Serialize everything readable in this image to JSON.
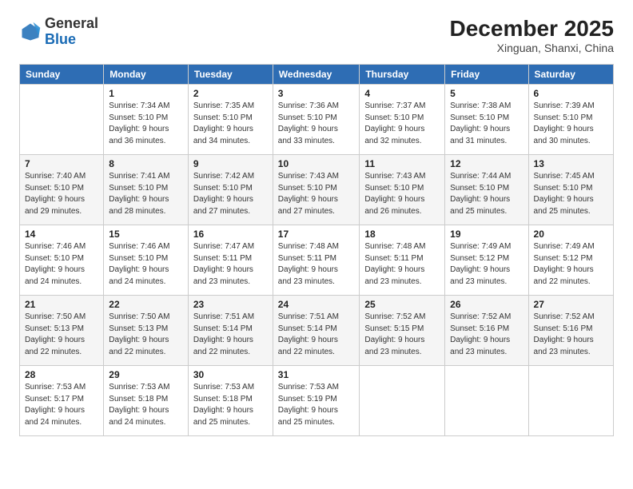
{
  "header": {
    "logo_general": "General",
    "logo_blue": "Blue",
    "month_title": "December 2025",
    "location": "Xinguan, Shanxi, China"
  },
  "columns": [
    "Sunday",
    "Monday",
    "Tuesday",
    "Wednesday",
    "Thursday",
    "Friday",
    "Saturday"
  ],
  "weeks": [
    [
      {
        "day": "",
        "info": ""
      },
      {
        "day": "1",
        "info": "Sunrise: 7:34 AM\nSunset: 5:10 PM\nDaylight: 9 hours\nand 36 minutes."
      },
      {
        "day": "2",
        "info": "Sunrise: 7:35 AM\nSunset: 5:10 PM\nDaylight: 9 hours\nand 34 minutes."
      },
      {
        "day": "3",
        "info": "Sunrise: 7:36 AM\nSunset: 5:10 PM\nDaylight: 9 hours\nand 33 minutes."
      },
      {
        "day": "4",
        "info": "Sunrise: 7:37 AM\nSunset: 5:10 PM\nDaylight: 9 hours\nand 32 minutes."
      },
      {
        "day": "5",
        "info": "Sunrise: 7:38 AM\nSunset: 5:10 PM\nDaylight: 9 hours\nand 31 minutes."
      },
      {
        "day": "6",
        "info": "Sunrise: 7:39 AM\nSunset: 5:10 PM\nDaylight: 9 hours\nand 30 minutes."
      }
    ],
    [
      {
        "day": "7",
        "info": "Sunrise: 7:40 AM\nSunset: 5:10 PM\nDaylight: 9 hours\nand 29 minutes."
      },
      {
        "day": "8",
        "info": "Sunrise: 7:41 AM\nSunset: 5:10 PM\nDaylight: 9 hours\nand 28 minutes."
      },
      {
        "day": "9",
        "info": "Sunrise: 7:42 AM\nSunset: 5:10 PM\nDaylight: 9 hours\nand 27 minutes."
      },
      {
        "day": "10",
        "info": "Sunrise: 7:43 AM\nSunset: 5:10 PM\nDaylight: 9 hours\nand 27 minutes."
      },
      {
        "day": "11",
        "info": "Sunrise: 7:43 AM\nSunset: 5:10 PM\nDaylight: 9 hours\nand 26 minutes."
      },
      {
        "day": "12",
        "info": "Sunrise: 7:44 AM\nSunset: 5:10 PM\nDaylight: 9 hours\nand 25 minutes."
      },
      {
        "day": "13",
        "info": "Sunrise: 7:45 AM\nSunset: 5:10 PM\nDaylight: 9 hours\nand 25 minutes."
      }
    ],
    [
      {
        "day": "14",
        "info": "Sunrise: 7:46 AM\nSunset: 5:10 PM\nDaylight: 9 hours\nand 24 minutes."
      },
      {
        "day": "15",
        "info": "Sunrise: 7:46 AM\nSunset: 5:10 PM\nDaylight: 9 hours\nand 24 minutes."
      },
      {
        "day": "16",
        "info": "Sunrise: 7:47 AM\nSunset: 5:11 PM\nDaylight: 9 hours\nand 23 minutes."
      },
      {
        "day": "17",
        "info": "Sunrise: 7:48 AM\nSunset: 5:11 PM\nDaylight: 9 hours\nand 23 minutes."
      },
      {
        "day": "18",
        "info": "Sunrise: 7:48 AM\nSunset: 5:11 PM\nDaylight: 9 hours\nand 23 minutes."
      },
      {
        "day": "19",
        "info": "Sunrise: 7:49 AM\nSunset: 5:12 PM\nDaylight: 9 hours\nand 23 minutes."
      },
      {
        "day": "20",
        "info": "Sunrise: 7:49 AM\nSunset: 5:12 PM\nDaylight: 9 hours\nand 22 minutes."
      }
    ],
    [
      {
        "day": "21",
        "info": "Sunrise: 7:50 AM\nSunset: 5:13 PM\nDaylight: 9 hours\nand 22 minutes."
      },
      {
        "day": "22",
        "info": "Sunrise: 7:50 AM\nSunset: 5:13 PM\nDaylight: 9 hours\nand 22 minutes."
      },
      {
        "day": "23",
        "info": "Sunrise: 7:51 AM\nSunset: 5:14 PM\nDaylight: 9 hours\nand 22 minutes."
      },
      {
        "day": "24",
        "info": "Sunrise: 7:51 AM\nSunset: 5:14 PM\nDaylight: 9 hours\nand 22 minutes."
      },
      {
        "day": "25",
        "info": "Sunrise: 7:52 AM\nSunset: 5:15 PM\nDaylight: 9 hours\nand 23 minutes."
      },
      {
        "day": "26",
        "info": "Sunrise: 7:52 AM\nSunset: 5:16 PM\nDaylight: 9 hours\nand 23 minutes."
      },
      {
        "day": "27",
        "info": "Sunrise: 7:52 AM\nSunset: 5:16 PM\nDaylight: 9 hours\nand 23 minutes."
      }
    ],
    [
      {
        "day": "28",
        "info": "Sunrise: 7:53 AM\nSunset: 5:17 PM\nDaylight: 9 hours\nand 24 minutes."
      },
      {
        "day": "29",
        "info": "Sunrise: 7:53 AM\nSunset: 5:18 PM\nDaylight: 9 hours\nand 24 minutes."
      },
      {
        "day": "30",
        "info": "Sunrise: 7:53 AM\nSunset: 5:18 PM\nDaylight: 9 hours\nand 25 minutes."
      },
      {
        "day": "31",
        "info": "Sunrise: 7:53 AM\nSunset: 5:19 PM\nDaylight: 9 hours\nand 25 minutes."
      },
      {
        "day": "",
        "info": ""
      },
      {
        "day": "",
        "info": ""
      },
      {
        "day": "",
        "info": ""
      }
    ]
  ]
}
